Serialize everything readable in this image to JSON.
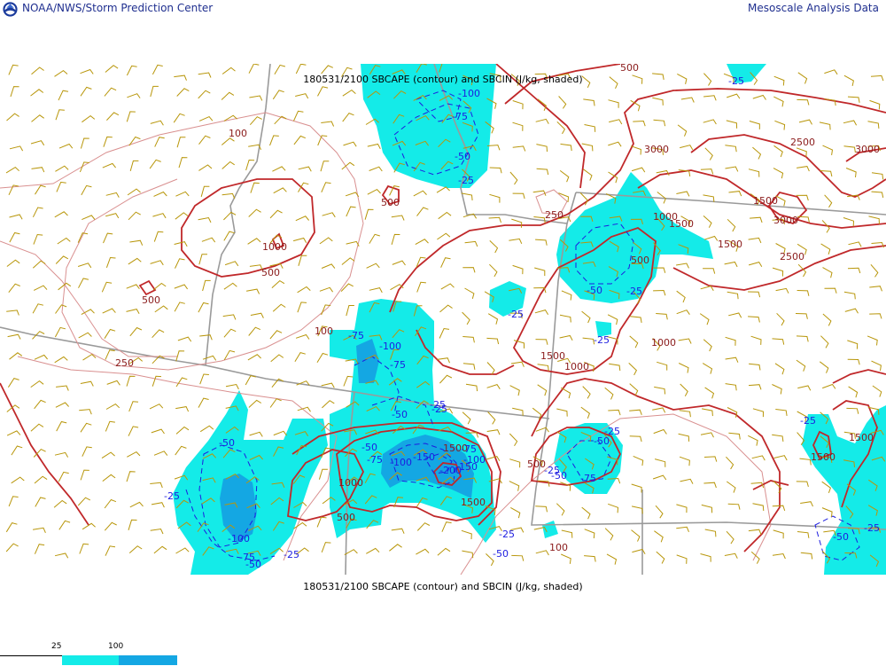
{
  "header": {
    "organization": "NOAA/NWS/Storm Prediction Center",
    "product": "Mesoscale Analysis Data"
  },
  "map": {
    "title_top": "180531/2100 SBCAPE (contour) and SBCIN (J/kg, shaded)",
    "title_bottom": "180531/2100 SBCAPE (contour) and SBCIN (J/kg, shaded)",
    "colors": {
      "cape_contour": "#c0282a",
      "cape_contour_light": "#d99090",
      "cin_light_fill": "#14ebe8",
      "cin_dark_fill": "#14a7e3",
      "cin_contour": "#1d1de0",
      "wind_barb": "#b8960a",
      "border": "#9a9a9a"
    },
    "cape_labels": [
      "100",
      "500",
      "1000",
      "500",
      "500",
      "250",
      "100",
      "250",
      "1000",
      "1500",
      "500",
      "1500",
      "1000",
      "500",
      "1000",
      "500",
      "1000",
      "1500",
      "1500",
      "1500",
      "2500",
      "3000",
      "3000",
      "2500",
      "3000",
      "1500",
      "1500",
      "1500",
      "100",
      "500"
    ],
    "cin_labels": [
      "-100",
      "-75",
      "-50",
      "-25",
      "-25",
      "-25",
      "-50",
      "-25",
      "-25",
      "-75",
      "-100",
      "-75",
      "-50",
      "-25",
      "-50",
      "-75",
      "-100",
      "-150",
      "-200",
      "-150",
      "-100",
      "-75",
      "-50",
      "-25",
      "-50",
      "-75",
      "-100",
      "-50",
      "-25",
      "-25",
      "-50",
      "-25",
      "-25",
      "-75",
      "-50",
      "-25",
      "-25",
      "-50",
      "-25"
    ]
  },
  "legend": {
    "values": [
      "25",
      "100"
    ],
    "colors": [
      "#14ebe8",
      "#14a7e3"
    ]
  }
}
